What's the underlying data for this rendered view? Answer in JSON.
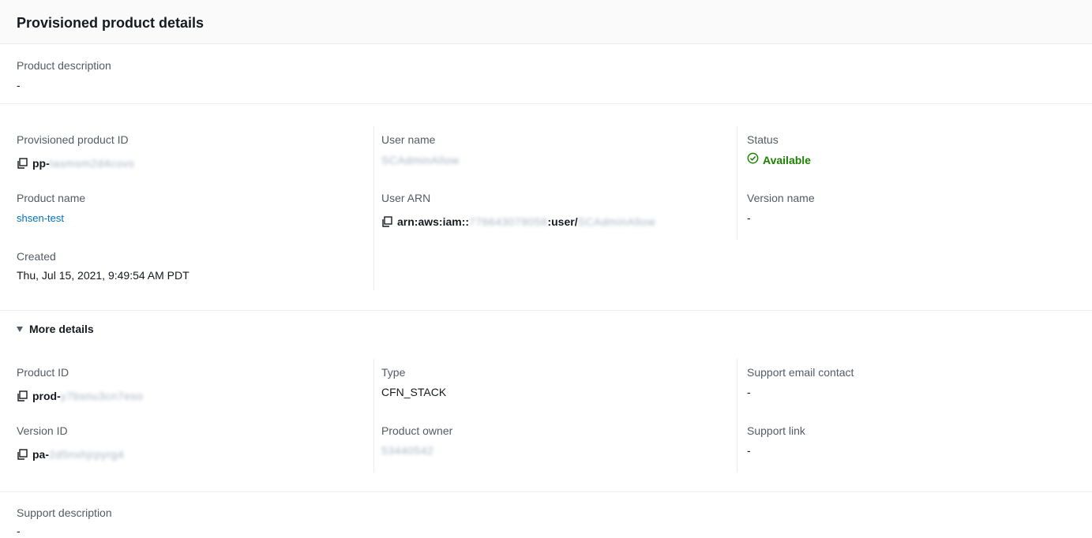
{
  "header": {
    "title": "Provisioned product details"
  },
  "product_description": {
    "label": "Product description",
    "value": "-"
  },
  "provisioned_product_id": {
    "label": "Provisioned product ID",
    "prefix": "pp-",
    "masked": "tasmsm2d4covs"
  },
  "user_name": {
    "label": "User name",
    "masked": "SCAdminAllow"
  },
  "status": {
    "label": "Status",
    "value": "Available",
    "color": "#1d8102"
  },
  "product_name": {
    "label": "Product name",
    "value": "shsen-test"
  },
  "user_arn": {
    "label": "User ARN",
    "prefix": "arn:aws:iam::",
    "masked_account": "776643078058",
    "mid": ":user/",
    "masked_user": "SCAdminAllow"
  },
  "version_name": {
    "label": "Version name",
    "value": "-"
  },
  "created": {
    "label": "Created",
    "value": "Thu, Jul 15, 2021, 9:49:54 AM PDT"
  },
  "more_details": {
    "label": "More details"
  },
  "product_id": {
    "label": "Product ID",
    "prefix": "prod-",
    "masked": "y7bsnu3cn7eso"
  },
  "type": {
    "label": "Type",
    "value": "CFN_STACK"
  },
  "support_email": {
    "label": "Support email contact",
    "value": "-"
  },
  "version_id": {
    "label": "Version ID",
    "prefix": "pa-",
    "masked": "2d5nxhjrpyrg4"
  },
  "product_owner": {
    "label": "Product owner",
    "masked": "53440542"
  },
  "support_link": {
    "label": "Support link",
    "value": "-"
  },
  "support_description": {
    "label": "Support description",
    "value": "-"
  },
  "icons": {
    "copy": "copy-icon",
    "status": "check-circle-icon",
    "toggle": "caret-down-icon"
  },
  "colors": {
    "link": "#0073bb",
    "label": "#545b64",
    "text": "#16191f",
    "success": "#1d8102"
  }
}
